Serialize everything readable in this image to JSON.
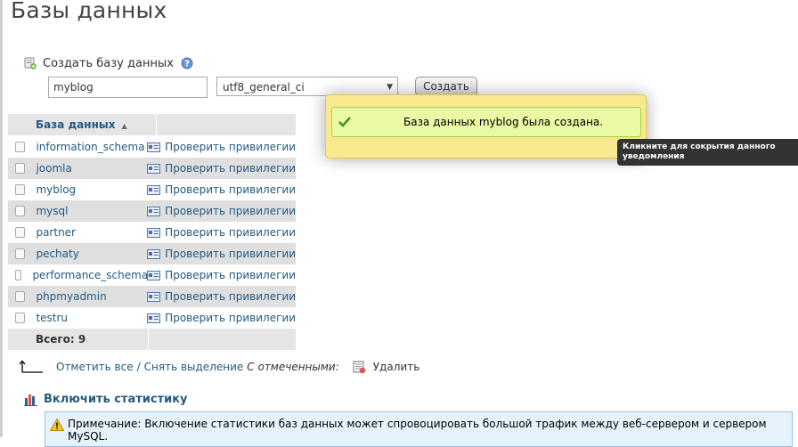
{
  "page": {
    "title": "Базы данных"
  },
  "create": {
    "heading": "Создать базу данных",
    "db_name_value": "myblog",
    "collation_selected": "utf8_general_ci",
    "create_label": "Создать"
  },
  "table": {
    "column_header": "База данных",
    "privileges_label": "Проверить привилегии",
    "rows": [
      {
        "name": "information_schema"
      },
      {
        "name": "joomla"
      },
      {
        "name": "myblog"
      },
      {
        "name": "mysql"
      },
      {
        "name": "partner"
      },
      {
        "name": "pechaty"
      },
      {
        "name": "performance_schema"
      },
      {
        "name": "phpmyadmin"
      },
      {
        "name": "testru"
      }
    ],
    "total_label": "Всего: 9"
  },
  "bulk": {
    "select_all": "Отметить все",
    "separator": "/",
    "deselect": "Снять выделение",
    "with_selected": "С отмеченными:",
    "delete_label": "Удалить"
  },
  "stats": {
    "enable_label": "Включить статистику"
  },
  "note": {
    "text": "Примечание: Включение статистики баз данных может спровоцировать большой трафик между веб-сервером и сервером MySQL."
  },
  "notification": {
    "message": "База данных myblog была создана.",
    "tooltip": "Кликните для сокрытия данного уведомления"
  },
  "colors": {
    "link": "#235a81",
    "notification_bg": "#f9e98e",
    "success_bg": "#ebf8a4",
    "row_alt": "#dfdfdf",
    "note_bg": "#e6f2fb"
  },
  "icons": {
    "create_db": "database-add-icon",
    "help": "help-icon",
    "privileges": "privileges-icon",
    "bulk_arrow": "arrow-ltr-icon",
    "delete": "delete-icon",
    "stats": "bar-chart-icon",
    "warning": "warning-icon",
    "success": "checkmark-icon"
  }
}
